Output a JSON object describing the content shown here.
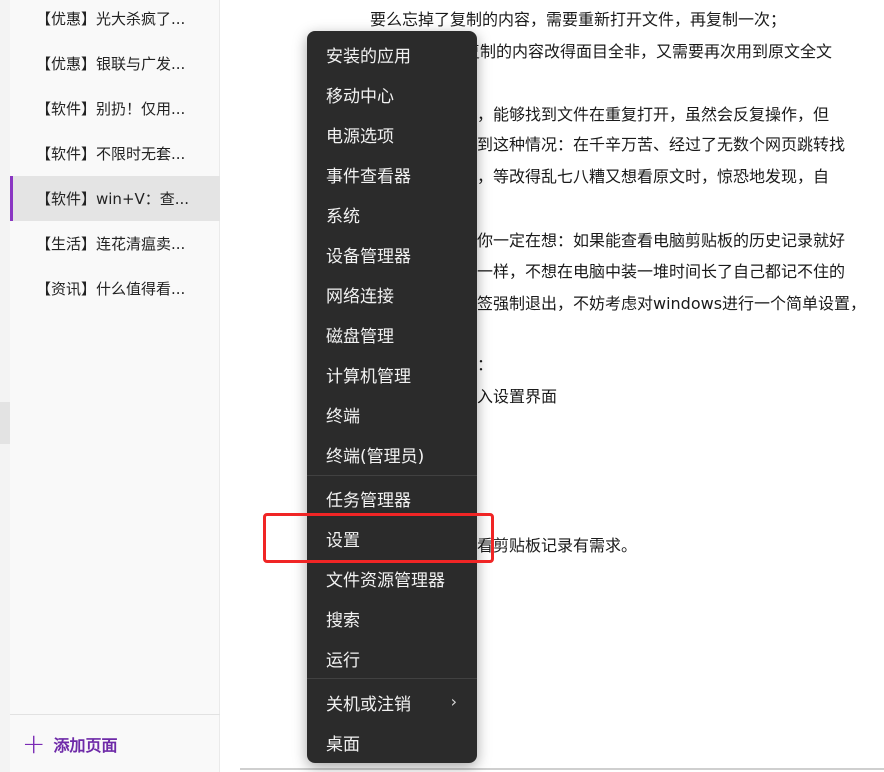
{
  "sidebar": {
    "pages": [
      {
        "label": "【优惠】光大杀疯了..."
      },
      {
        "label": "【优惠】银联与广发..."
      },
      {
        "label": "【软件】别扔！仅用..."
      },
      {
        "label": "【软件】不限时无套..."
      },
      {
        "label": "【软件】win+V：查..."
      },
      {
        "label": "【生活】连花清瘟卖..."
      },
      {
        "label": "【资讯】什么值得看..."
      }
    ],
    "add_page_label": "添加页面"
  },
  "content": {
    "lines": [
      "要么忘掉了复制的内容，需要重新打开文件，再复制一次；",
      "复制的内容改得面目全非，又需要再次用到原文全文",
      "，能够找到文件在重复打开，虽然会反复操作，但",
      "到这种情况：在千辛万苦、经过了无数个网页跳转找",
      "，等改得乱七八糟又想看原文时，惊恐地发现，自",
      "你一定在想：如果能查看电脑剪贴板的历史记录就好",
      "一样，不想在电脑中装一堆时间长了自己都记不住的",
      "签强制退出，不妨考虑对windows进行一个简单设置，",
      "：",
      "入设置界面",
      "看剪贴板记录有需求。"
    ]
  },
  "context_menu": {
    "items": [
      {
        "label": "安装的应用"
      },
      {
        "label": "移动中心"
      },
      {
        "label": "电源选项"
      },
      {
        "label": "事件查看器"
      },
      {
        "label": "系统"
      },
      {
        "label": "设备管理器"
      },
      {
        "label": "网络连接"
      },
      {
        "label": "磁盘管理"
      },
      {
        "label": "计算机管理"
      },
      {
        "label": "终端"
      },
      {
        "label": "终端(管理员)"
      },
      {
        "label": "任务管理器"
      },
      {
        "label": "设置"
      },
      {
        "label": "文件资源管理器"
      },
      {
        "label": "搜索"
      },
      {
        "label": "运行"
      },
      {
        "label": "关机或注销"
      },
      {
        "label": "桌面"
      }
    ],
    "submenu_icon": "chevron-right-icon",
    "highlighted_item": "设置"
  },
  "colors": {
    "accent": "#7b2bb5",
    "menu_bg": "#2b2b2b",
    "highlight": "#f02525"
  }
}
